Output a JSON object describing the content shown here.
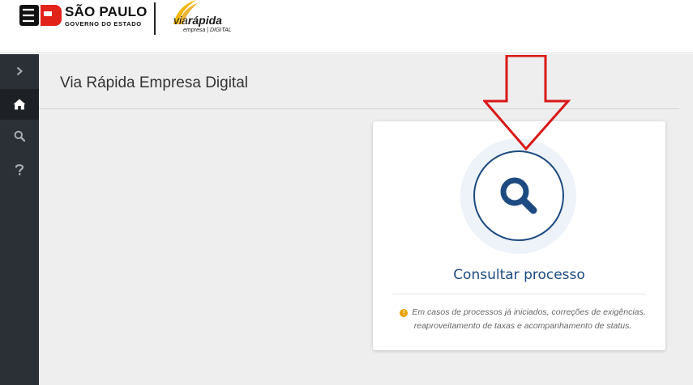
{
  "header": {
    "sp_logo": {
      "title": "SÃO PAULO",
      "subtitle": "GOVERNO DO ESTADO"
    },
    "viarapida_logo": {
      "word_plain": "via",
      "word_bold": "rápida",
      "subtitle": "empresa | DIGITAL"
    }
  },
  "sidebar": {
    "items": [
      {
        "icon": "chevron-right-icon",
        "active": false
      },
      {
        "icon": "home-icon",
        "active": true
      },
      {
        "icon": "search-icon",
        "active": false
      },
      {
        "icon": "question-icon",
        "active": false
      }
    ]
  },
  "main": {
    "page_title": "Via Rápida Empresa Digital",
    "card": {
      "icon": "search-icon",
      "title": "Consultar processo",
      "note_icon": "info-icon",
      "note": "Em casos de processos já iniciados, correções de exigências, reaproveitamento de taxas e acompanhamento de status."
    }
  },
  "colors": {
    "sidebar_bg": "#2b3036",
    "main_bg": "#eeeeee",
    "card_accent": "#1d4a80",
    "info_icon": "#e8a200",
    "annotation_arrow": "#d81818"
  }
}
